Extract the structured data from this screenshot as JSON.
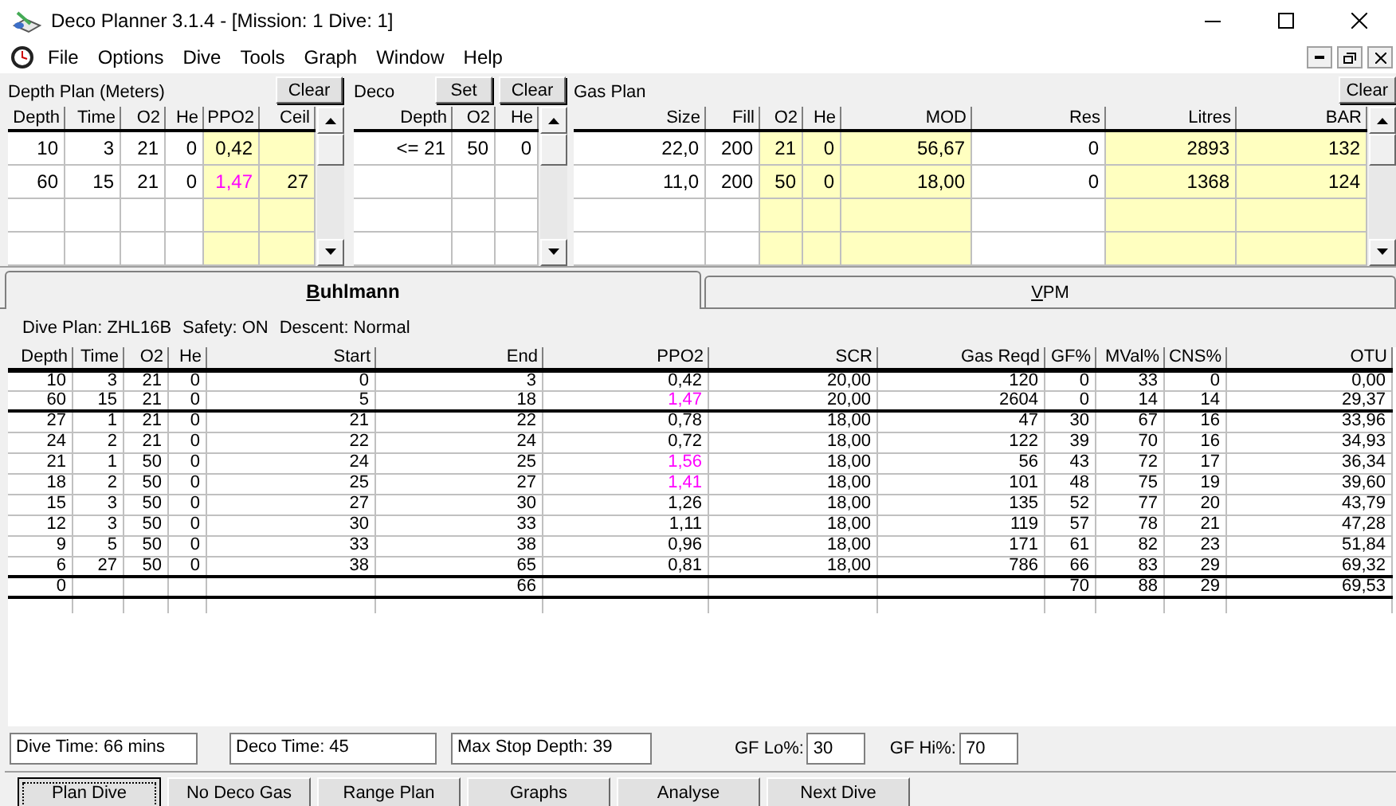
{
  "window": {
    "title": "Deco Planner 3.1.4 - [Mission: 1 Dive: 1]"
  },
  "menu": [
    "File",
    "Options",
    "Dive",
    "Tools",
    "Graph",
    "Window",
    "Help"
  ],
  "depth_plan": {
    "title": "Depth Plan (Meters)",
    "clear_button": "Clear",
    "columns": [
      {
        "label": "Depth",
        "shaded": false
      },
      {
        "label": "Time",
        "shaded": false
      },
      {
        "label": "O2",
        "shaded": false
      },
      {
        "label": "He",
        "shaded": false
      },
      {
        "label": "PPO2",
        "shaded": true
      },
      {
        "label": "Ceil",
        "shaded": true
      }
    ],
    "rows": [
      {
        "cells": [
          "10",
          "3",
          "21",
          "0",
          "0,42",
          null
        ],
        "ppo2_high": false
      },
      {
        "cells": [
          "60",
          "15",
          "21",
          "0",
          "1,47",
          "27"
        ],
        "ppo2_high": true
      }
    ]
  },
  "deco": {
    "title": "Deco",
    "set_button": "Set",
    "clear_button": "Clear",
    "columns": [
      {
        "label": "Depth",
        "shaded": false
      },
      {
        "label": "O2",
        "shaded": false
      },
      {
        "label": "He",
        "shaded": false
      }
    ],
    "rows": [
      {
        "cells": [
          "<= 21",
          "50",
          "0"
        ]
      }
    ]
  },
  "gas_plan": {
    "title": "Gas Plan",
    "clear_button": "Clear",
    "columns": [
      {
        "label": "Size",
        "shaded": false
      },
      {
        "label": "Fill",
        "shaded": false
      },
      {
        "label": "O2",
        "shaded": true
      },
      {
        "label": "He",
        "shaded": true
      },
      {
        "label": "MOD",
        "shaded": true
      },
      {
        "label": "Res",
        "shaded": false
      },
      {
        "label": "Litres",
        "shaded": true
      },
      {
        "label": "BAR",
        "shaded": true
      }
    ],
    "rows": [
      {
        "cells": [
          "22,0",
          "200",
          "21",
          "0",
          "56,67",
          "0",
          "2893",
          "132"
        ]
      },
      {
        "cells": [
          "11,0",
          "200",
          "50",
          "0",
          "18,00",
          "0",
          "1368",
          "124"
        ]
      }
    ]
  },
  "tabs": [
    {
      "label": "Buhlmann",
      "selected": true
    },
    {
      "label": "VPM",
      "selected": false
    }
  ],
  "plan_info": [
    "Dive Plan: ZHL16B",
    "Safety: ON",
    "Descent: Normal"
  ],
  "results": {
    "columns": [
      "Depth",
      "Time",
      "O2",
      "He",
      "Start",
      "End",
      "PPO2",
      "SCR",
      "Gas Reqd",
      "GF%",
      "MVal%",
      "CNS%",
      "OTU"
    ],
    "rows": [
      {
        "kind": "descent",
        "ppo2_high": false,
        "cells": [
          "10",
          "3",
          "21",
          "0",
          "0",
          "3",
          "0,42",
          "20,00",
          "120",
          "0",
          "33",
          "0",
          "0,00"
        ]
      },
      {
        "kind": "descent",
        "ppo2_high": true,
        "cells": [
          "60",
          "15",
          "21",
          "0",
          "5",
          "18",
          "1,47",
          "20,00",
          "2604",
          "0",
          "14",
          "14",
          "29,37"
        ]
      },
      {
        "kind": "stop",
        "ppo2_high": false,
        "cells": [
          "27",
          "1",
          "21",
          "0",
          "21",
          "22",
          "0,78",
          "18,00",
          "47",
          "30",
          "67",
          "16",
          "33,96"
        ]
      },
      {
        "kind": "stop",
        "ppo2_high": false,
        "cells": [
          "24",
          "2",
          "21",
          "0",
          "22",
          "24",
          "0,72",
          "18,00",
          "122",
          "39",
          "70",
          "16",
          "34,93"
        ]
      },
      {
        "kind": "stop",
        "ppo2_high": true,
        "cells": [
          "21",
          "1",
          "50",
          "0",
          "24",
          "25",
          "1,56",
          "18,00",
          "56",
          "43",
          "72",
          "17",
          "36,34"
        ]
      },
      {
        "kind": "stop",
        "ppo2_high": true,
        "cells": [
          "18",
          "2",
          "50",
          "0",
          "25",
          "27",
          "1,41",
          "18,00",
          "101",
          "48",
          "75",
          "19",
          "39,60"
        ]
      },
      {
        "kind": "stop",
        "ppo2_high": false,
        "cells": [
          "15",
          "3",
          "50",
          "0",
          "27",
          "30",
          "1,26",
          "18,00",
          "135",
          "52",
          "77",
          "20",
          "43,79"
        ]
      },
      {
        "kind": "stop",
        "ppo2_high": false,
        "cells": [
          "12",
          "3",
          "50",
          "0",
          "30",
          "33",
          "1,11",
          "18,00",
          "119",
          "57",
          "78",
          "21",
          "47,28"
        ]
      },
      {
        "kind": "stop",
        "ppo2_high": false,
        "cells": [
          "9",
          "5",
          "50",
          "0",
          "33",
          "38",
          "0,96",
          "18,00",
          "171",
          "61",
          "82",
          "23",
          "51,84"
        ]
      },
      {
        "kind": "stop",
        "ppo2_high": false,
        "cells": [
          "6",
          "27",
          "50",
          "0",
          "38",
          "65",
          "0,81",
          "18,00",
          "786",
          "66",
          "83",
          "29",
          "69,32"
        ]
      },
      {
        "kind": "total",
        "cells": [
          "0",
          null,
          null,
          null,
          null,
          "66",
          null,
          null,
          null,
          "70",
          "88",
          "29",
          "69,53"
        ]
      }
    ]
  },
  "status": {
    "dive_time": "Dive Time: 66 mins",
    "deco_time": "Deco Time: 45",
    "max_stop_depth": "Max Stop Depth: 39",
    "gf_lo": {
      "label": "GF Lo%:",
      "value": "30"
    },
    "gf_hi": {
      "label": "GF Hi%:",
      "value": "70"
    }
  },
  "buttons": [
    {
      "label": "Plan Dive",
      "focused": true
    },
    {
      "label": "No Deco Gas",
      "focused": false
    },
    {
      "label": "Range Plan",
      "focused": false
    },
    {
      "label": "Graphs",
      "focused": false
    },
    {
      "label": "Analyse",
      "focused": false
    },
    {
      "label": "Next Dive",
      "focused": false
    }
  ]
}
